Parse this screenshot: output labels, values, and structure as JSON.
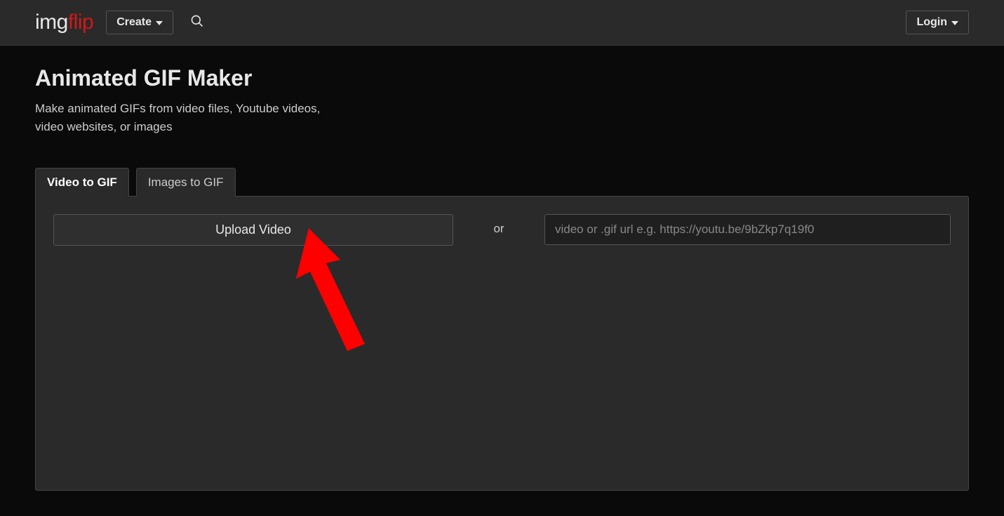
{
  "header": {
    "logo_part1": "img",
    "logo_part2": "flip",
    "create_label": "Create",
    "login_label": "Login"
  },
  "page": {
    "title": "Animated GIF Maker",
    "subtitle": "Make animated GIFs from video files, Youtube videos, video websites, or images"
  },
  "tabs": {
    "video": "Video to GIF",
    "images": "Images to GIF"
  },
  "upload": {
    "button_label": "Upload Video",
    "or_label": "or",
    "url_placeholder": "video or .gif url e.g. https://youtu.be/9bZkp7q19f0"
  }
}
